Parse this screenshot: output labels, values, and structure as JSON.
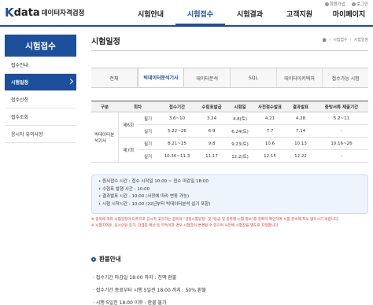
{
  "header": {
    "logo_k": "K",
    "logo_data": "data",
    "logo_text": "데이터자격검정",
    "utils": [
      "회원가입",
      "로그인"
    ],
    "gnb": [
      "시험안내",
      "시험접수",
      "시험결과",
      "고객지원",
      "마이페이지"
    ]
  },
  "sidebar": {
    "title": "시험접수",
    "items": [
      "접수안내",
      "시험일정",
      "접수신청",
      "접수조회",
      "응시자 유의사항"
    ]
  },
  "main": {
    "title": "시험일정",
    "breadcrumb": [
      "시험접수",
      "시험일정"
    ],
    "tabs": [
      "전체",
      "빅데이터분석기사",
      "데이터분석",
      "SQL",
      "데이터아키텍처",
      "접수가능 시험"
    ]
  },
  "table": {
    "headers": [
      "구분",
      "회차",
      "",
      "접수기간",
      "수험표발급",
      "시험일",
      "사전점수발표",
      "결과발표",
      "증빙서류 제출기간"
    ],
    "group": "빅데이터분석기사",
    "rounds": [
      "제6회",
      "제7회"
    ],
    "rows": [
      [
        "필기",
        "3.6~10",
        "3.24",
        "4.8(토)",
        "4.21",
        "4.28",
        "5.2~11"
      ],
      [
        "실기",
        "5.22~26",
        "6.9",
        "6.24(토)",
        "7.7",
        "7.14",
        "-"
      ],
      [
        "필기",
        "8.21~25",
        "9.8",
        "9.23(토)",
        "10.6",
        "10.13",
        "10.16~26"
      ],
      [
        "실기",
        "10.30~11.3",
        "11.17",
        "12.2(토)",
        "12.15",
        "12.22",
        "-"
      ]
    ]
  },
  "info": {
    "lines": [
      "• 원서접수 시간 : 접수 시작일 10:00 ~ 접수 마감일 18:00",
      "• 수험표 발행 시간 : 10:00",
      "• 결과발표 시간 : 10:00 (사정에 따라 변동 가능)",
      "• 시험 시작시간 : 10:00 (22년부터 빅데이터분석 실기 포함)"
    ]
  },
  "notes": [
    "※ 종목에 따라 시험일정이 다르므로 응시자 고유하는 종목의 \"검정시험일정\" 및 \"등급 및 종목별 시험 정보\"를 정확히 확인하여 시험 준비에 착오 없으시기 바랍니다.",
    "※ 시험지역은, 응시인원 증가, 감염증 확산 등 부득이한 경우 시험장이 변경될 수 있으며 사전에 시험장을 별도로 지정합니다."
  ],
  "refund": {
    "title": "환불안내",
    "items": [
      "· 접수기간 마감일 18:00 까지 : 전액 환불",
      "· 접수기간 종료부터 시행 5일전 18:00 까지 : 50% 환불",
      "· 시행 5일전 18:00 이후 : 환불 불가"
    ]
  },
  "colors": {
    "brand": "#1c4f9c",
    "note_red": "#d9302d",
    "info_bg": "#eef4fb"
  }
}
